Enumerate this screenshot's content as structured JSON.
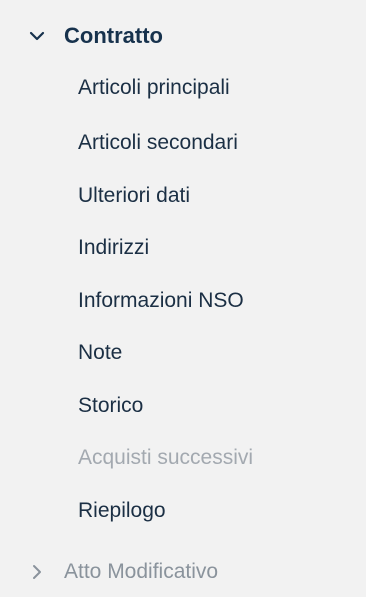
{
  "menu": {
    "section": {
      "label": "Contratto",
      "expanded": true,
      "icon": "chevron-down-icon"
    },
    "items": [
      {
        "label": "Articoli principali",
        "enabled": true
      },
      {
        "label": "Articoli secondari",
        "enabled": true
      },
      {
        "label": "Ulteriori dati",
        "enabled": true
      },
      {
        "label": "Indirizzi",
        "enabled": true
      },
      {
        "label": "Informazioni NSO",
        "enabled": true
      },
      {
        "label": "Note",
        "enabled": true
      },
      {
        "label": "Storico",
        "enabled": true
      },
      {
        "label": "Acquisti successivi",
        "enabled": false
      },
      {
        "label": "Riepilogo",
        "enabled": true
      }
    ],
    "next_section": {
      "label": "Atto Modificativo",
      "expanded": false,
      "icon": "chevron-right-icon"
    }
  },
  "colors": {
    "background": "#f2f2f2",
    "text": "#1b2f44",
    "disabled": "#a3a9b0",
    "collapsed_section": "#8a939c"
  }
}
